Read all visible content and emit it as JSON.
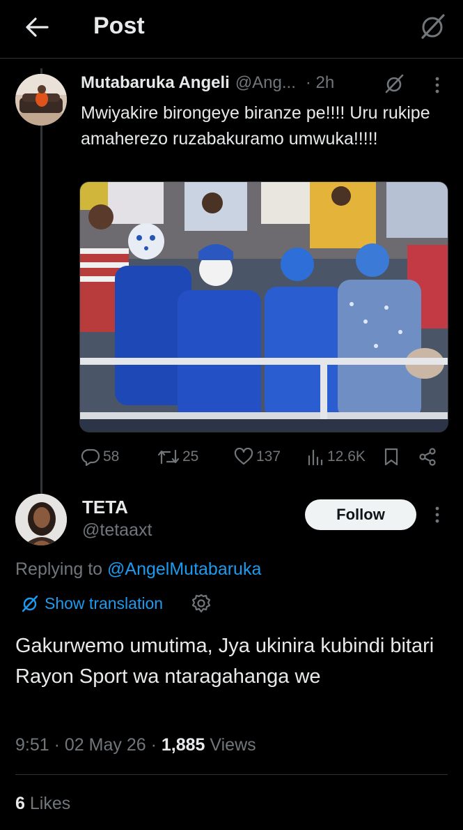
{
  "header": {
    "title": "Post"
  },
  "parent_post": {
    "author_name": "Mutabaruka Angeli",
    "author_handle": "@Ang...",
    "time": "· 2h",
    "text": "Mwiyakire birongeye biranze pe!!!! Uru rukipe amaherezo ruzabakuramo umwuka!!!!!",
    "stats": {
      "replies": "58",
      "reposts": "25",
      "likes": "137",
      "views": "12.6K"
    }
  },
  "reply_post": {
    "author_name": "TETA",
    "author_handle": "@tetaaxt",
    "follow_label": "Follow",
    "replying_prefix": "Replying to",
    "replying_to": "@AngelMutabaruka",
    "translation_label": "Show translation",
    "text": "Gakurwemo umutima, Jya ukinira kubindi bitari Rayon Sport wa ntaragahanga we",
    "time": "9:51",
    "date": "02 May 26",
    "views_count": "1,885",
    "views_label": "Views",
    "likes_count": "6",
    "likes_label": "Likes"
  },
  "colors": {
    "background": "#000000",
    "text": "#e7e9ea",
    "muted": "#71767b",
    "accent": "#1d9bf0",
    "border": "#2f3336"
  }
}
